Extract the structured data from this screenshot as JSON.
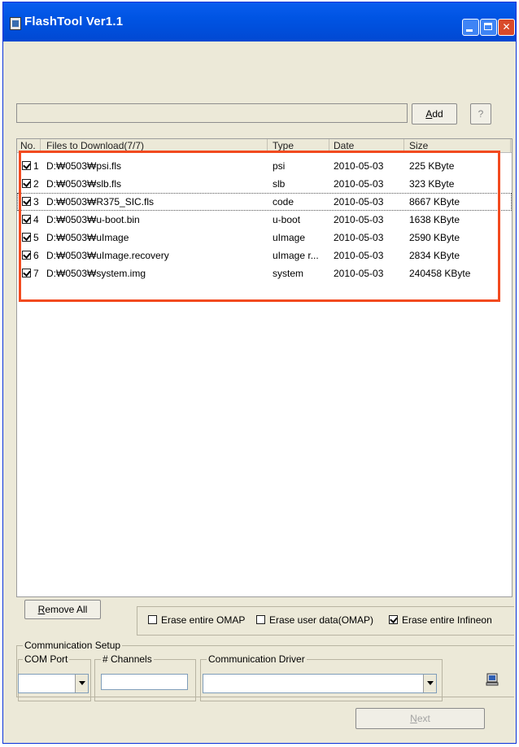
{
  "window": {
    "title": "FlashTool Ver1.1"
  },
  "toolbar": {
    "path_value": "",
    "add_label": "Add",
    "help_label": "?"
  },
  "list": {
    "columns": [
      "No.",
      "Files to Download(7/7)",
      "Type",
      "Date",
      "Size"
    ],
    "rows": [
      {
        "no": "1",
        "file": "D:₩0503₩psi.fls",
        "type": "psi",
        "date": "2010-05-03",
        "size": "225 KByte",
        "checked": true
      },
      {
        "no": "2",
        "file": "D:₩0503₩slb.fls",
        "type": "slb",
        "date": "2010-05-03",
        "size": "323 KByte",
        "checked": true
      },
      {
        "no": "3",
        "file": "D:₩0503₩R375_SIC.fls",
        "type": "code",
        "date": "2010-05-03",
        "size": "8667 KByte",
        "checked": true
      },
      {
        "no": "4",
        "file": "D:₩0503₩u-boot.bin",
        "type": "u-boot",
        "date": "2010-05-03",
        "size": "1638 KByte",
        "checked": true
      },
      {
        "no": "5",
        "file": "D:₩0503₩uImage",
        "type": "uImage",
        "date": "2010-05-03",
        "size": "2590 KByte",
        "checked": true
      },
      {
        "no": "6",
        "file": "D:₩0503₩uImage.recovery",
        "type": "uImage r...",
        "date": "2010-05-03",
        "size": "2834 KByte",
        "checked": true
      },
      {
        "no": "7",
        "file": "D:₩0503₩system.img",
        "type": "system",
        "date": "2010-05-03",
        "size": "240458 KByte",
        "checked": true
      }
    ]
  },
  "actions": {
    "remove_all": "Remove All",
    "next": "Next"
  },
  "options": {
    "erase_omap": {
      "label": "Erase entire OMAP",
      "checked": false
    },
    "erase_user": {
      "label": "Erase user data(OMAP)",
      "checked": false
    },
    "erase_infineon": {
      "label": "Erase entire Infineon",
      "checked": true
    }
  },
  "comm": {
    "group_label": "Communication Setup",
    "com_port_label": "COM Port",
    "channels_label": "# Channels",
    "driver_label": "Communication Driver",
    "com_port_value": "",
    "channels_value": "",
    "driver_value": ""
  },
  "colors": {
    "title_bar": "#0054E3",
    "highlight": "#F24A1F",
    "face": "#ECE9D8"
  }
}
